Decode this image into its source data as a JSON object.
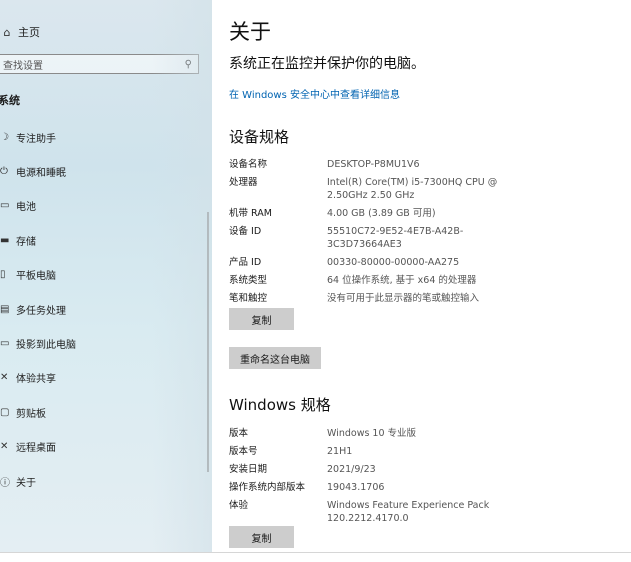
{
  "sidebar": {
    "home": {
      "icon": "home-icon",
      "glyph": "⌂",
      "label": "主页"
    },
    "search": {
      "placeholder": "查找设置",
      "icon": "search-icon",
      "glyph": "⚲"
    },
    "section_title": "系统",
    "items": [
      {
        "icon": "focus-assist-icon",
        "glyph": "☽",
        "label": "专注助手"
      },
      {
        "icon": "power-sleep-icon",
        "glyph": "⏻",
        "label": "电源和睡眠"
      },
      {
        "icon": "battery-icon",
        "glyph": "▭",
        "label": "电池"
      },
      {
        "icon": "storage-icon",
        "glyph": "▬",
        "label": "存储"
      },
      {
        "icon": "tablet-icon",
        "glyph": "▯",
        "label": "平板电脑"
      },
      {
        "icon": "multitasking-icon",
        "glyph": "▤",
        "label": "多任务处理"
      },
      {
        "icon": "projecting-icon",
        "glyph": "▭",
        "label": "投影到此电脑"
      },
      {
        "icon": "shared-experiences-icon",
        "glyph": "✕",
        "label": "体验共享"
      },
      {
        "icon": "clipboard-icon",
        "glyph": "▢",
        "label": "剪贴板"
      },
      {
        "icon": "remote-desktop-icon",
        "glyph": "✕",
        "label": "远程桌面"
      },
      {
        "icon": "info-icon",
        "glyph": "ⓘ",
        "label": "关于"
      }
    ]
  },
  "main": {
    "title": "关于",
    "protect_text": "系统正在监控并保护你的电脑。",
    "security_link": "在 Windows 安全中心中查看详细信息",
    "device_specs": {
      "heading": "设备规格",
      "rows": [
        {
          "k": "设备名称",
          "v": "DESKTOP-P8MU1V6"
        },
        {
          "k": "处理器",
          "v": "Intel(R) Core(TM) i5-7300HQ CPU @ 2.50GHz 2.50 GHz"
        },
        {
          "k": "机带 RAM",
          "v": "4.00 GB (3.89 GB 可用)"
        },
        {
          "k": "设备 ID",
          "v": "55510C72-9E52-4E7B-A42B-3C3D73664AE3"
        },
        {
          "k": "产品 ID",
          "v": "00330-80000-00000-AA275"
        },
        {
          "k": "系统类型",
          "v": "64 位操作系统, 基于 x64 的处理器"
        },
        {
          "k": "笔和触控",
          "v": "没有可用于此显示器的笔或触控输入"
        }
      ],
      "copy_button": "复制"
    },
    "rename_button": "重命名这台电脑",
    "windows_specs": {
      "heading": "Windows 规格",
      "rows": [
        {
          "k": "版本",
          "v": "Windows 10 专业版"
        },
        {
          "k": "版本号",
          "v": "21H1"
        },
        {
          "k": "安装日期",
          "v": "2021/9/23"
        },
        {
          "k": "操作系统内部版本",
          "v": "19043.1706"
        },
        {
          "k": "体验",
          "v": "Windows Feature Experience Pack 120.2212.4170.0"
        }
      ],
      "copy_button": "复制"
    }
  },
  "colors": {
    "link": "#0063b1",
    "button": "#cdcdcd"
  }
}
